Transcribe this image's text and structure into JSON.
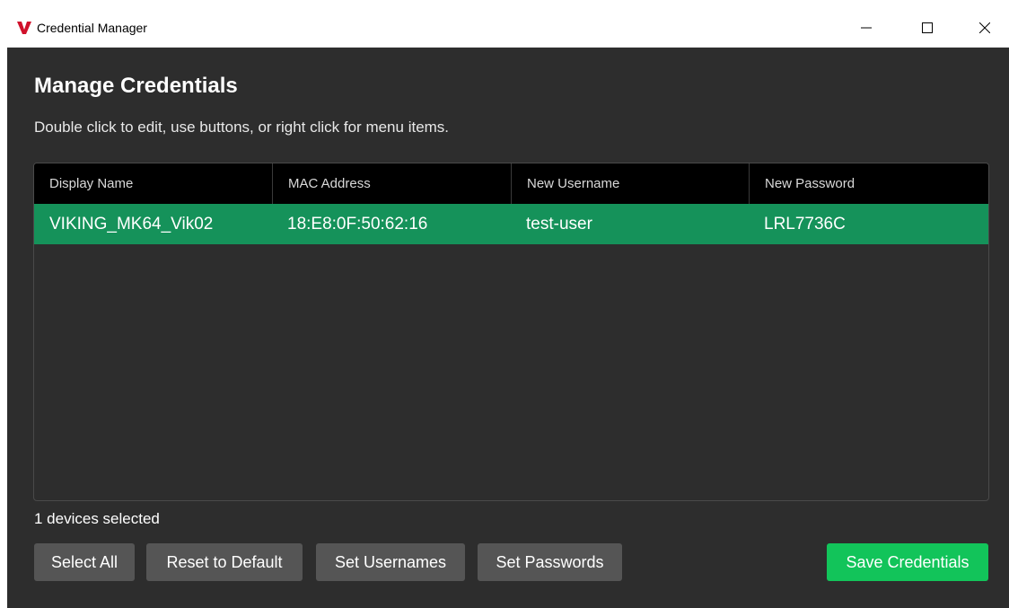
{
  "window": {
    "title": "Credential Manager",
    "icon": "viking-logo-icon",
    "controls": [
      "minimize-icon",
      "maximize-icon",
      "close-icon"
    ]
  },
  "main": {
    "heading": "Manage Credentials",
    "subtitle": "Double click to edit, use buttons, or right click for menu items."
  },
  "table": {
    "columns": [
      "Display Name",
      "MAC Address",
      "New Username",
      "New Password"
    ],
    "rows": [
      {
        "display_name": "VIKING_MK64_Vik02",
        "mac_address": "18:E8:0F:50:62:16",
        "new_username": "test-user",
        "new_password": "LRL7736C",
        "selected": true
      }
    ]
  },
  "status": {
    "text": "1 devices selected"
  },
  "buttons": {
    "select_all": "Select All",
    "reset_default": "Reset to Default",
    "set_usernames": "Set Usernames",
    "set_passwords": "Set Passwords",
    "save_credentials": "Save Credentials"
  },
  "colors": {
    "background": "#2d2d2d",
    "header": "#000000",
    "selected_row": "#15925a",
    "button": "#555555",
    "save_button": "#12c45a",
    "logo_red": "#d0112b"
  }
}
